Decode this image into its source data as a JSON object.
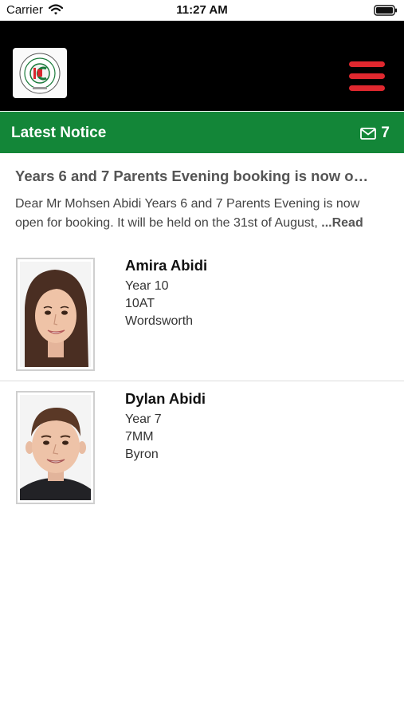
{
  "status_bar": {
    "carrier": "Carrier",
    "time": "11:27 AM"
  },
  "header": {
    "logo_icon": "school-crest-icon",
    "menu_icon": "hamburger-menu-icon"
  },
  "notice_bar": {
    "title": "Latest Notice",
    "mail_icon": "envelope-icon",
    "count": "7"
  },
  "notice": {
    "heading": "Years 6 and 7 Parents Evening booking is now o…",
    "body": "Dear Mr Mohsen Abidi Years 6 and 7 Parents Evening is now open for booking. It will be held on the 31st of August,",
    "read_more": "...Read"
  },
  "students": [
    {
      "name": "Amira Abidi",
      "year": "Year 10",
      "form": "10AT",
      "house": "Wordsworth"
    },
    {
      "name": "Dylan Abidi",
      "year": "Year 7",
      "form": "7MM",
      "house": "Byron"
    }
  ],
  "colors": {
    "header_bg": "#000000",
    "notice_bar": "#138638",
    "menu_red": "#e0282f"
  }
}
